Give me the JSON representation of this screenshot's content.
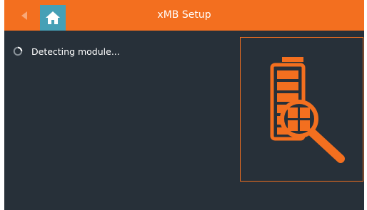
{
  "header": {
    "title": "xMB Setup",
    "back_icon": "triangle-left-icon",
    "home_icon": "home-icon"
  },
  "status": {
    "text": "Detecting module...",
    "icon": "loading-spinner-icon"
  },
  "preview": {
    "icon": "battery-search-icon"
  },
  "colors": {
    "accent": "#f36f1f",
    "home_button": "#46a0b6",
    "background": "#273039",
    "text": "#ffffff"
  }
}
